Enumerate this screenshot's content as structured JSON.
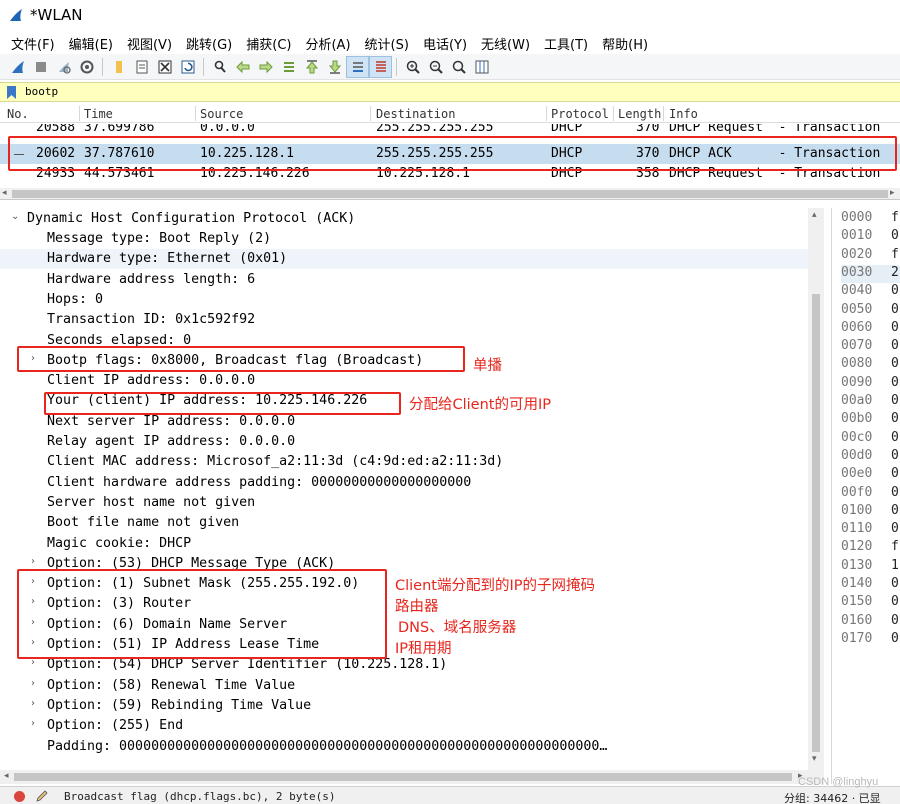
{
  "window": {
    "title": "*WLAN"
  },
  "menu": [
    "文件(F)",
    "编辑(E)",
    "视图(V)",
    "跳转(G)",
    "捕获(C)",
    "分析(A)",
    "统计(S)",
    "电话(Y)",
    "无线(W)",
    "工具(T)",
    "帮助(H)"
  ],
  "toolbar": {
    "icons": [
      "shark-fin-start-icon",
      "stop-capture-icon",
      "restart-capture-icon",
      "capture-options-icon",
      "open-file-icon",
      "save-file-icon",
      "close-file-icon",
      "reload-file-icon",
      "find-packet-icon",
      "go-back-icon",
      "go-forward-icon",
      "go-to-packet-icon",
      "go-first-icon",
      "go-last-icon",
      "auto-scroll-icon",
      "colorize-icon",
      "zoom-in-icon",
      "zoom-out-icon",
      "normal-size-icon",
      "resize-columns-icon"
    ]
  },
  "filter": {
    "value": "bootp"
  },
  "packet_list": {
    "columns": [
      "No.",
      "Time",
      "Source",
      "Destination",
      "Protocol",
      "Length",
      "Info"
    ],
    "rows": [
      {
        "no": "20588",
        "time": "37.699786",
        "source": "0.0.0.0",
        "destination": "255.255.255.255",
        "protocol": "DHCP",
        "length": "370",
        "info": "DHCP Request  - Transaction"
      },
      {
        "no": "20602",
        "time": "37.787610",
        "source": "10.225.128.1",
        "destination": "255.255.255.255",
        "protocol": "DHCP",
        "length": "370",
        "info": "DHCP ACK      - Transaction"
      },
      {
        "no": "24933",
        "time": "44.573461",
        "source": "10.225.146.226",
        "destination": "10.225.128.1",
        "protocol": "DHCP",
        "length": "358",
        "info": "DHCP Request  - Transaction"
      }
    ]
  },
  "details": {
    "root": "Dynamic Host Configuration Protocol (ACK)",
    "lines": [
      {
        "text": "Message type: Boot Reply (2)",
        "expandable": false
      },
      {
        "text": "Hardware type: Ethernet (0x01)",
        "expandable": false
      },
      {
        "text": "Hardware address length: 6",
        "expandable": false
      },
      {
        "text": "Hops: 0",
        "expandable": false
      },
      {
        "text": "Transaction ID: 0x1c592f92",
        "expandable": false
      },
      {
        "text": "Seconds elapsed: 0",
        "expandable": false
      },
      {
        "text": "Bootp flags: 0x8000, Broadcast flag (Broadcast)",
        "expandable": true
      },
      {
        "text": "Client IP address: 0.0.0.0",
        "expandable": false
      },
      {
        "text": "Your (client) IP address: 10.225.146.226",
        "expandable": false
      },
      {
        "text": "Next server IP address: 0.0.0.0",
        "expandable": false
      },
      {
        "text": "Relay agent IP address: 0.0.0.0",
        "expandable": false
      },
      {
        "text": "Client MAC address: Microsof_a2:11:3d (c4:9d:ed:a2:11:3d)",
        "expandable": false
      },
      {
        "text": "Client hardware address padding: 00000000000000000000",
        "expandable": false
      },
      {
        "text": "Server host name not given",
        "expandable": false
      },
      {
        "text": "Boot file name not given",
        "expandable": false
      },
      {
        "text": "Magic cookie: DHCP",
        "expandable": false
      },
      {
        "text": "Option: (53) DHCP Message Type (ACK)",
        "expandable": true
      },
      {
        "text": "Option: (1) Subnet Mask (255.255.192.0)",
        "expandable": true
      },
      {
        "text": "Option: (3) Router",
        "expandable": true
      },
      {
        "text": "Option: (6) Domain Name Server",
        "expandable": true
      },
      {
        "text": "Option: (51) IP Address Lease Time",
        "expandable": true
      },
      {
        "text": "Option: (54) DHCP Server Identifier (10.225.128.1)",
        "expandable": true
      },
      {
        "text": "Option: (58) Renewal Time Value",
        "expandable": true
      },
      {
        "text": "Option: (59) Rebinding Time Value",
        "expandable": true
      },
      {
        "text": "Option: (255) End",
        "expandable": true
      },
      {
        "text": "Padding: 000000000000000000000000000000000000000000000000000000000000…",
        "expandable": false
      }
    ]
  },
  "bytes": {
    "rows": [
      {
        "offset": "0000",
        "hex": "f"
      },
      {
        "offset": "0010",
        "hex": "0"
      },
      {
        "offset": "0020",
        "hex": "f"
      },
      {
        "offset": "0030",
        "hex": "2"
      },
      {
        "offset": "0040",
        "hex": "0"
      },
      {
        "offset": "0050",
        "hex": "0"
      },
      {
        "offset": "0060",
        "hex": "0"
      },
      {
        "offset": "0070",
        "hex": "0"
      },
      {
        "offset": "0080",
        "hex": "0"
      },
      {
        "offset": "0090",
        "hex": "0"
      },
      {
        "offset": "00a0",
        "hex": "0"
      },
      {
        "offset": "00b0",
        "hex": "0"
      },
      {
        "offset": "00c0",
        "hex": "0"
      },
      {
        "offset": "00d0",
        "hex": "0"
      },
      {
        "offset": "00e0",
        "hex": "0"
      },
      {
        "offset": "00f0",
        "hex": "0"
      },
      {
        "offset": "0100",
        "hex": "0"
      },
      {
        "offset": "0110",
        "hex": "0"
      },
      {
        "offset": "0120",
        "hex": "f"
      },
      {
        "offset": "0130",
        "hex": "1"
      },
      {
        "offset": "0140",
        "hex": "0"
      },
      {
        "offset": "0150",
        "hex": "0"
      },
      {
        "offset": "0160",
        "hex": "0"
      },
      {
        "offset": "0170",
        "hex": "0"
      }
    ]
  },
  "annotations": {
    "broadcast": "单播",
    "your_ip": "分配给Client的可用IP",
    "subnet": "Client端分配到的IP的子网掩码",
    "router": "路由器",
    "dns": "DNS、域名服务器",
    "lease": "IP租用期"
  },
  "status": {
    "text": "Broadcast flag (dhcp.flags.bc), 2 byte(s)",
    "right": "分组: 34462 · 已显",
    "watermark": "CSDN @linghyu"
  },
  "colors": {
    "selected_row": "#c6dcef",
    "filter_bg": "#ffffbe",
    "annotation": "#e8261d"
  }
}
